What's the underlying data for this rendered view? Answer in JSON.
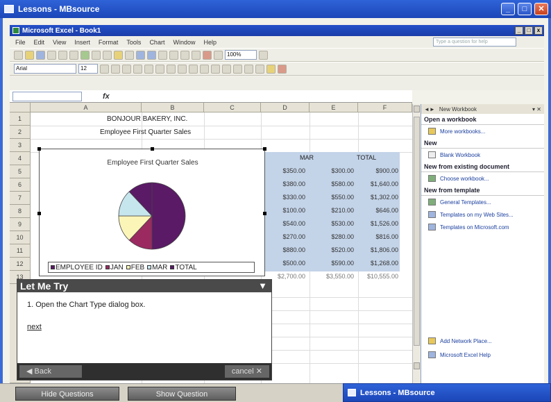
{
  "outer_window": {
    "title": "Lessons - MBsource",
    "btn_min": "_",
    "btn_max": "□",
    "btn_close": "✕"
  },
  "excel_window": {
    "title": "Microsoft Excel - Book1",
    "btn_min": "_",
    "btn_max": "□",
    "btn_close": "x"
  },
  "menu": {
    "items": [
      "File",
      "Edit",
      "View",
      "Insert",
      "Format",
      "Tools",
      "Chart",
      "Window",
      "Help"
    ],
    "ask_placeholder": "Type a question for help"
  },
  "toolbar": {
    "zoom": "100%",
    "font_name": "Arial",
    "font_size": "12"
  },
  "sheet": {
    "columns": [
      "A",
      "B",
      "C",
      "D",
      "E",
      "F"
    ],
    "rows": [
      "1",
      "2",
      "3",
      "4",
      "5",
      "6",
      "7",
      "8",
      "9",
      "10",
      "11",
      "12",
      "13"
    ],
    "title1": "BONJOUR BAKERY, INC.",
    "title2": "Employee First Quarter Sales",
    "hdr_mar": "MAR",
    "hdr_total": "TOTAL",
    "col_d": [
      "$350.00",
      "$380.00",
      "$330.00",
      "$100.00",
      "$540.00",
      "$270.00",
      "$880.00",
      "$500.00",
      "$2,700.00"
    ],
    "col_e": [
      "$300.00",
      "$580.00",
      "$550.00",
      "$210.00",
      "$530.00",
      "$280.00",
      "$520.00",
      "$590.00",
      "$3,550.00"
    ],
    "col_f": [
      "$900.00",
      "$1,640.00",
      "$1,302.00",
      "$646.00",
      "$1,526.00",
      "$816.00",
      "$1,806.00",
      "$1,268.00",
      "$10,555.00"
    ]
  },
  "chart_data": {
    "type": "pie",
    "title": "Employee First Quarter Sales",
    "slices": [
      {
        "label": "EMPLOYEE ID",
        "value": 50,
        "color": "#5a1a66"
      },
      {
        "label": "JAN",
        "value": 12,
        "color": "#9a2a60"
      },
      {
        "label": "FEB",
        "value": 13,
        "color": "#fbf6b8"
      },
      {
        "label": "MAR",
        "value": 13,
        "color": "#c6e6ee"
      },
      {
        "label": "TOTAL",
        "value": 12,
        "color": "#5a1a66"
      }
    ],
    "legend": [
      "EMPLOYEE ID",
      "JAN",
      "FEB",
      "MAR",
      "TOTAL"
    ],
    "legend_position": "bottom"
  },
  "task_pane": {
    "title": "New Workbook",
    "sections": [
      {
        "heading": "Open a workbook",
        "links": [
          "More workbooks..."
        ]
      },
      {
        "heading": "New",
        "links": [
          "Blank Workbook"
        ]
      },
      {
        "heading": "New from existing document",
        "links": [
          "Choose workbook..."
        ]
      },
      {
        "heading": "New from template",
        "links": [
          "General Templates...",
          "Templates on my Web Sites...",
          "Templates on Microsoft.com"
        ]
      }
    ],
    "footer_links": [
      "Add Network Place...",
      "Microsoft Excel Help"
    ]
  },
  "let_me_try": {
    "title": "Let Me Try",
    "step": "1. Open the Chart Type dialog box.",
    "next": "next",
    "back": "Back",
    "cancel": "cancel",
    "cancel_x": "✕"
  },
  "bottom": {
    "hide_questions": "Hide Questions",
    "show_question": "Show Question"
  },
  "second_window": {
    "title": "Lessons - MBsource"
  }
}
